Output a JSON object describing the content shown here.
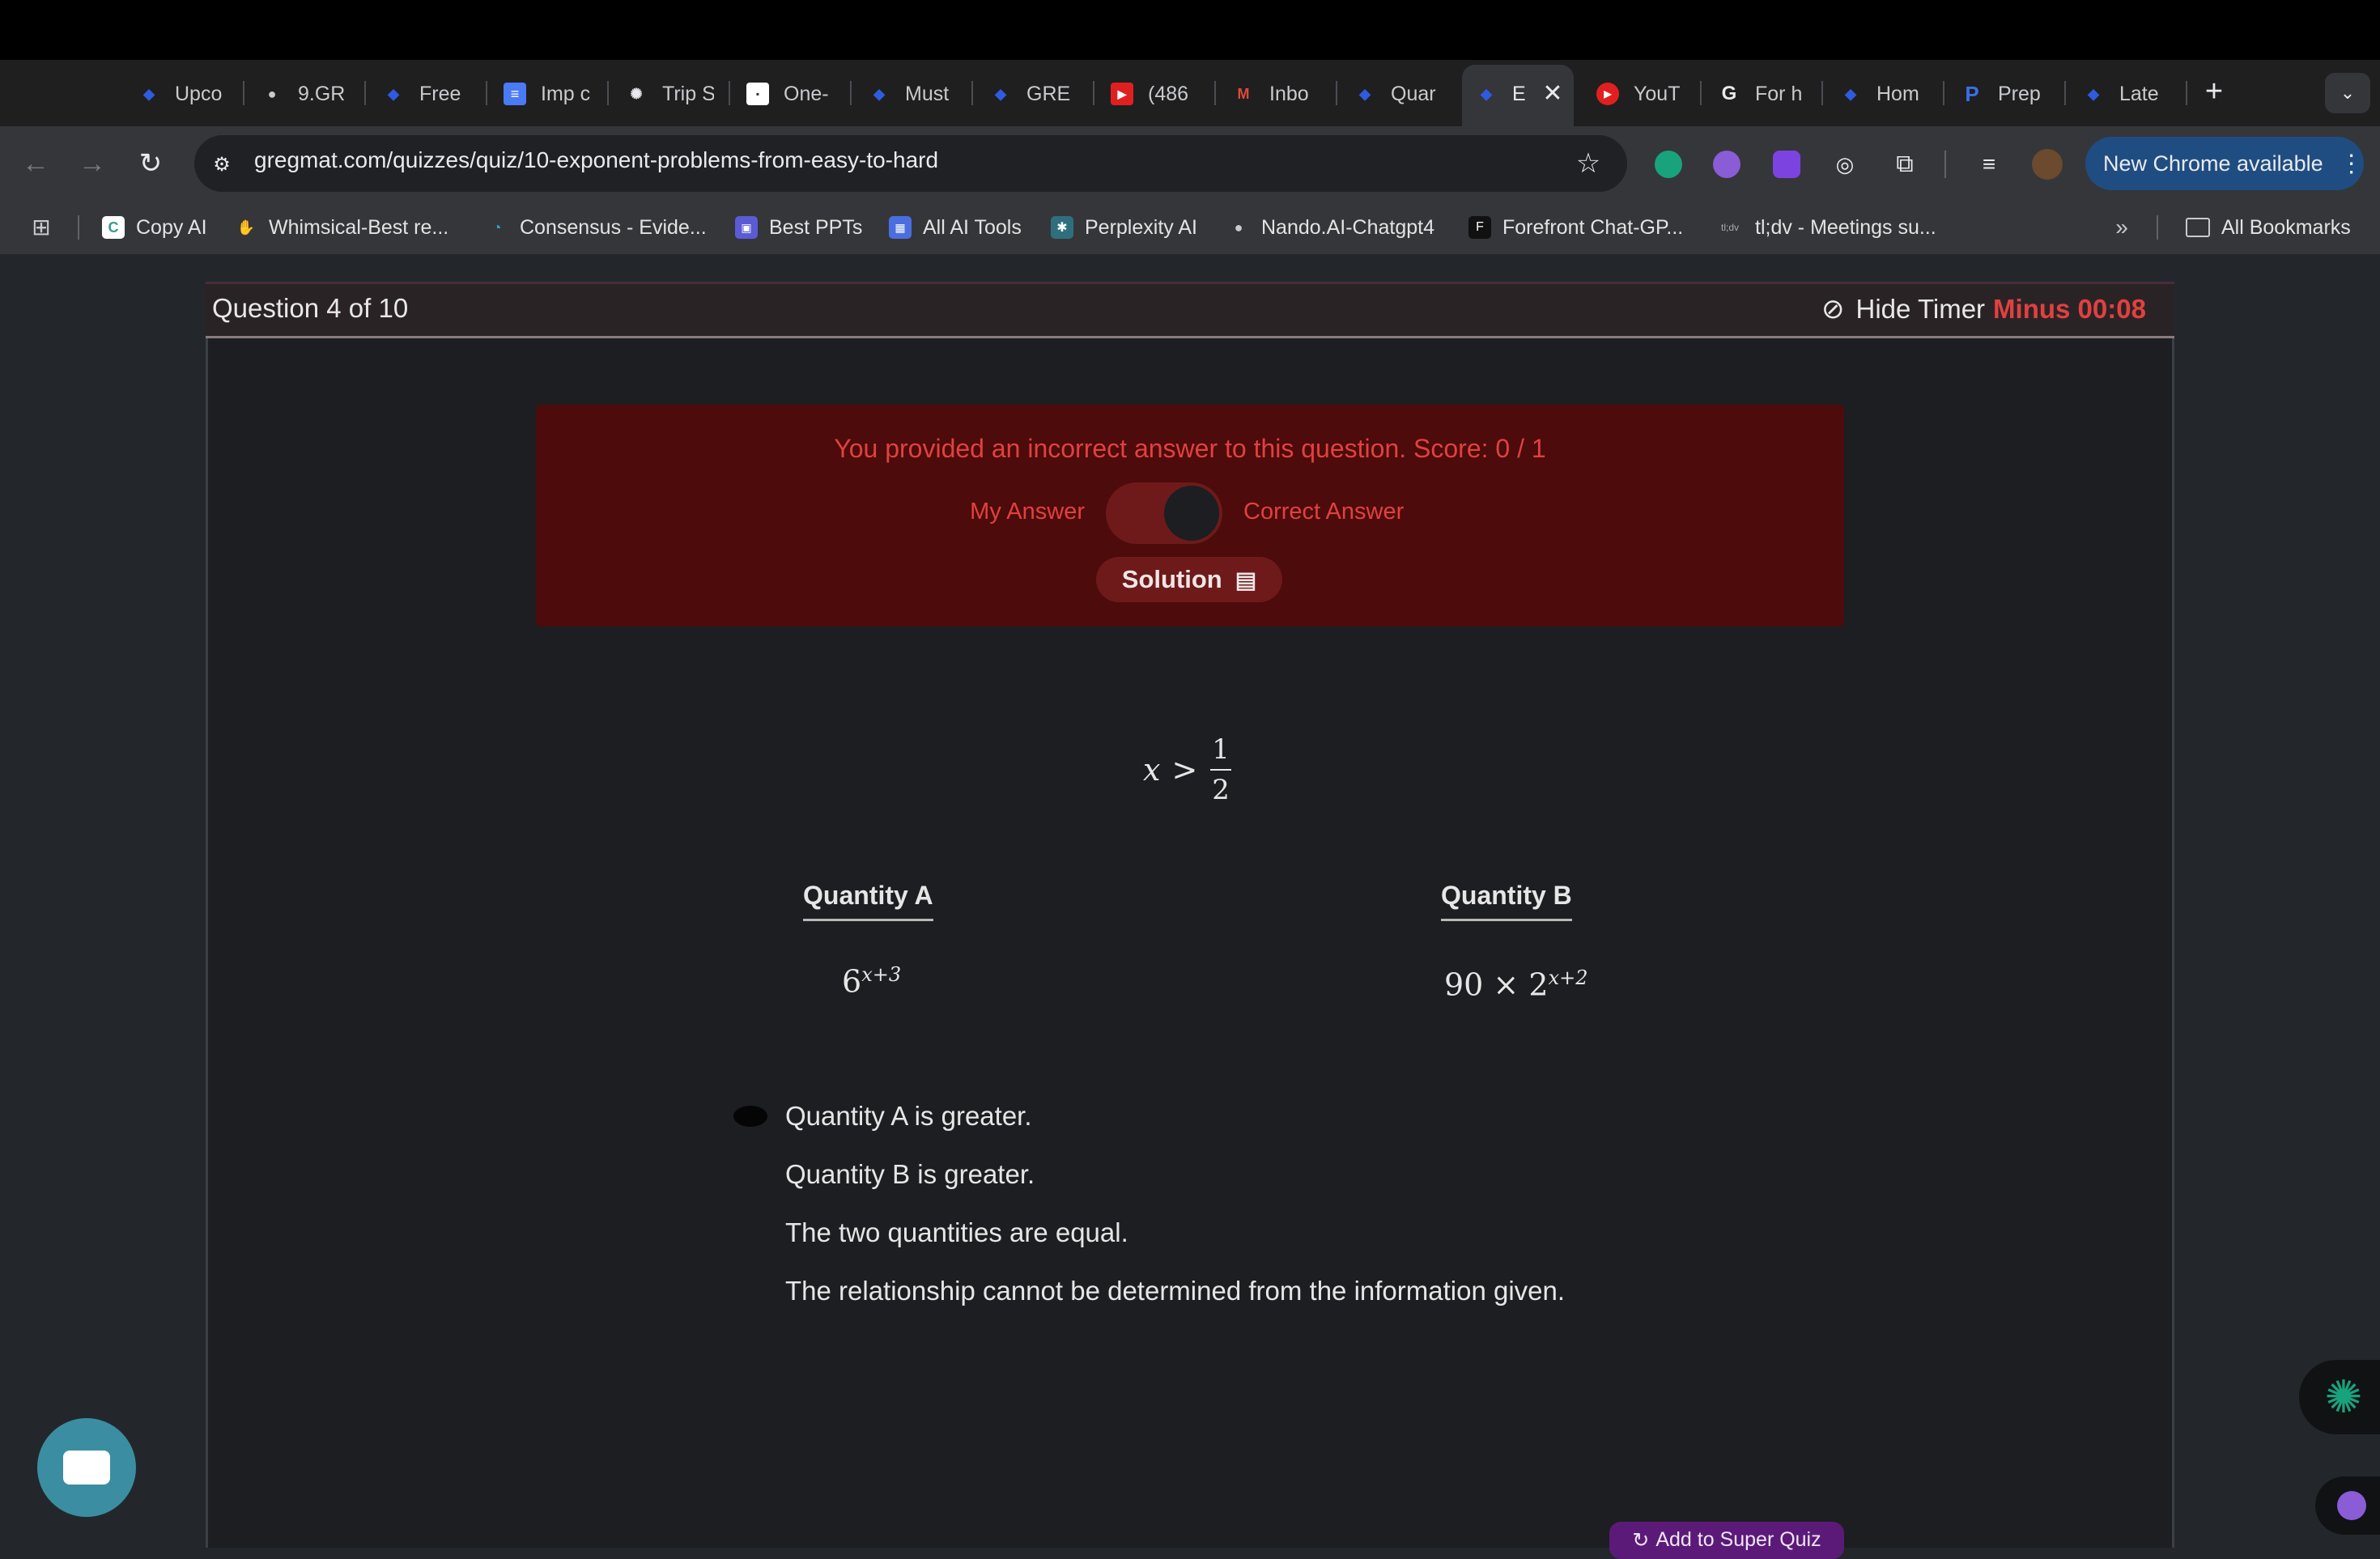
{
  "browser": {
    "tabs": [
      {
        "label": "Upco",
        "icon": "gregmat-icon"
      },
      {
        "label": "9.GR",
        "icon": "globe-icon"
      },
      {
        "label": "Free",
        "icon": "gregmat-icon"
      },
      {
        "label": "Imp c",
        "icon": "docs-icon"
      },
      {
        "label": "Trip S",
        "icon": "chatgpt-icon"
      },
      {
        "label": "One-",
        "icon": "page-icon"
      },
      {
        "label": "Must",
        "icon": "gregmat-icon"
      },
      {
        "label": "GRE",
        "icon": "gregmat-icon"
      },
      {
        "label": "(486",
        "icon": "youtube-icon"
      },
      {
        "label": "Inbo",
        "icon": "gmail-icon"
      },
      {
        "label": "Quar",
        "icon": "gregmat-icon"
      },
      {
        "label": "E",
        "icon": "gregmat-icon",
        "active": true
      },
      {
        "label": "YouT",
        "icon": "youtube-music-icon"
      },
      {
        "label": "For h",
        "icon": "google-icon"
      },
      {
        "label": "Hom",
        "icon": "gregmat-icon"
      },
      {
        "label": "Prep",
        "icon": "prep-icon"
      },
      {
        "label": "Late",
        "icon": "gregmat-icon"
      }
    ],
    "url": "gregmat.com/quizzes/quiz/10-exponent-problems-from-easy-to-hard",
    "new_chrome_label": "New Chrome available",
    "bookmarks": [
      {
        "label": "Copy AI"
      },
      {
        "label": "Whimsical-Best re..."
      },
      {
        "label": "Consensus - Evide..."
      },
      {
        "label": "Best PPTs"
      },
      {
        "label": "All AI Tools"
      },
      {
        "label": "Perplexity AI"
      },
      {
        "label": "Nando.AI-Chatgpt4"
      },
      {
        "label": "Forefront Chat-GP..."
      },
      {
        "label": "tl;dv - Meetings su..."
      }
    ],
    "all_bookmarks_label": "All Bookmarks"
  },
  "quiz": {
    "progress": "Question 4 of 10",
    "hide_timer_label": "Hide Timer",
    "timer": "Minus 00:08",
    "result_message": "You provided an incorrect answer to this question. Score: 0 / 1",
    "my_answer_label": "My Answer",
    "correct_answer_label": "Correct Answer",
    "solution_label": "Solution",
    "condition": {
      "lhs": "x",
      "op": ">",
      "num": "1",
      "den": "2"
    },
    "quantity_a_label": "Quantity A",
    "quantity_b_label": "Quantity B",
    "quantity_a": {
      "base": "6",
      "exp": "x+3"
    },
    "quantity_b": {
      "coef": "90 ×",
      "base": "2",
      "exp": "x+2"
    },
    "choices": [
      "Quantity A is greater.",
      "Quantity B is greater.",
      "The two quantities are equal.",
      "The relationship cannot be determined from the information given."
    ],
    "selected_choice": 0,
    "add_super_quiz_label": "Add to Super Quiz"
  },
  "colors": {
    "error_red": "#e0413f",
    "result_bg": "#4d0b0b",
    "chrome_blue": "#1f4d82",
    "chat_bubble": "#3b8ea1"
  }
}
